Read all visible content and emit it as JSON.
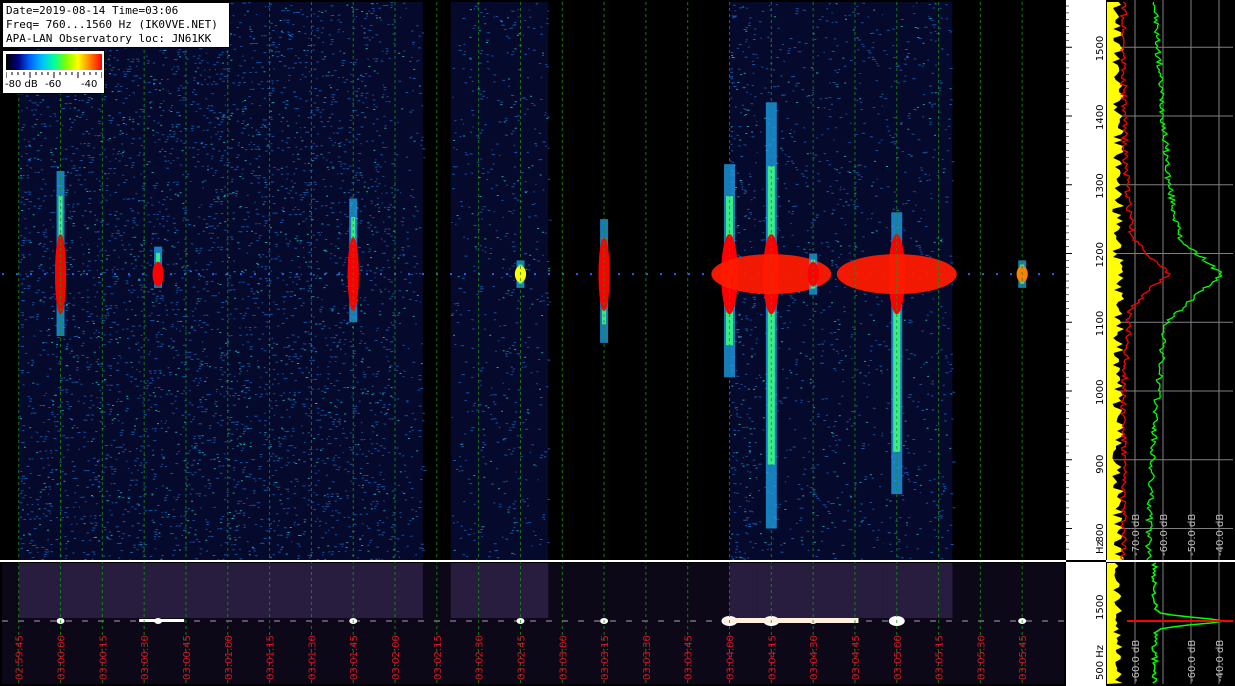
{
  "info": {
    "line1": "Date=2019-08-14 Time=03:06",
    "line2": "Freq= 760...1560 Hz (IK0VVE.NET)",
    "line3": "APA-LAN Observatory loc: JN61KK"
  },
  "scale": {
    "labels": [
      "-80 dB",
      "-60",
      "-40"
    ],
    "colors": [
      "#000000",
      "#000080",
      "#0060ff",
      "#00c0ff",
      "#00ffa0",
      "#80ff00",
      "#ffff00",
      "#ff8000",
      "#ff0000"
    ]
  },
  "chart_data": [
    {
      "type": "heatmap",
      "title": "Date=2019-08-14 Time=03:06",
      "xlabel": "",
      "ylabel": "Hz",
      "y_ticks": [
        800,
        900,
        1000,
        1100,
        1200,
        1300,
        1400,
        1500
      ],
      "ylim": [
        760,
        1560
      ],
      "x_ticks": [
        "02:59:45",
        "03:00:00",
        "03:00:15",
        "03:00:30",
        "03:00:45",
        "03:01:00",
        "03:01:15",
        "03:01:30",
        "03:01:45",
        "03:02:00",
        "03:02:15",
        "03:02:30",
        "03:02:45",
        "03:03:00",
        "03:03:15",
        "03:03:30",
        "03:03:45",
        "03:04:00",
        "03:04:15",
        "03:04:30",
        "03:04:45",
        "03:05:00",
        "03:05:15",
        "03:05:30",
        "03:05:45"
      ],
      "carrier_hz": 1170,
      "noise_blocks": [
        {
          "t_start": "02:59:45",
          "t_end": "03:02:00",
          "level_db": -65
        },
        {
          "t_start": "03:02:00",
          "t_end": "03:02:10",
          "level_db": -80
        },
        {
          "t_start": "03:02:20",
          "t_end": "03:02:55",
          "level_db": -72
        },
        {
          "t_start": "03:04:00",
          "t_end": "03:04:10",
          "level_db": -68
        },
        {
          "t_start": "03:04:10",
          "t_end": "03:04:55",
          "level_db": -72
        },
        {
          "t_start": "03:04:55",
          "t_end": "03:05:20",
          "level_db": -75
        }
      ],
      "echoes": [
        {
          "time": "03:00:00",
          "freq_low": 1080,
          "freq_high": 1320,
          "peak_db": -40
        },
        {
          "time": "03:00:35",
          "freq_low": 1150,
          "freq_high": 1210,
          "peak_db": -42
        },
        {
          "time": "03:01:45",
          "freq_low": 1100,
          "freq_high": 1280,
          "peak_db": -40
        },
        {
          "time": "03:02:45",
          "freq_low": 1150,
          "freq_high": 1190,
          "peak_db": -50
        },
        {
          "time": "03:03:15",
          "freq_low": 1070,
          "freq_high": 1250,
          "peak_db": -40
        },
        {
          "time": "03:04:00",
          "freq_low": 1020,
          "freq_high": 1330,
          "peak_db": -38
        },
        {
          "time": "03:04:15",
          "freq_low": 800,
          "freq_high": 1420,
          "peak_db": -38
        },
        {
          "time": "03:04:30",
          "freq_low": 1140,
          "freq_high": 1200,
          "peak_db": -40
        },
        {
          "time": "03:05:00",
          "freq_low": 850,
          "freq_high": 1260,
          "peak_db": -38
        },
        {
          "time": "03:05:45",
          "freq_low": 1150,
          "freq_high": 1190,
          "peak_db": -45
        }
      ]
    },
    {
      "type": "line",
      "title": "",
      "xlabel": "",
      "ylabel": "",
      "x_ticks": [
        "-70.0 dB",
        "-60.0 dB",
        "-50.0 dB",
        "-40.0 dB"
      ],
      "xlim": [
        -80,
        -35
      ],
      "series": [
        {
          "color": "#00ff00",
          "freq": [
            1560,
            1500,
            1400,
            1300,
            1220,
            1190,
            1170,
            1140,
            1100,
            1000,
            900,
            800,
            760
          ],
          "db": [
            -63,
            -62,
            -60,
            -58,
            -54,
            -45,
            -39,
            -48,
            -59,
            -62,
            -64,
            -65,
            -65
          ]
        },
        {
          "color": "#ff0000",
          "freq": [
            1560,
            1400,
            1300,
            1220,
            1190,
            1170,
            1150,
            1120,
            1000,
            900,
            760
          ],
          "db": [
            -74,
            -74,
            -73,
            -71,
            -63,
            -58,
            -64,
            -72,
            -74,
            -74,
            -74
          ]
        },
        {
          "color": "#ffff00",
          "freq": [
            1560,
            760
          ],
          "db": [
            -76,
            -76
          ]
        }
      ]
    }
  ],
  "lower": {
    "y_ticks": [
      "1500",
      "500 Hz"
    ],
    "x_ticks": [
      "-60.0",
      "-60.0",
      "-40.0"
    ],
    "x_suffix": "dB"
  }
}
